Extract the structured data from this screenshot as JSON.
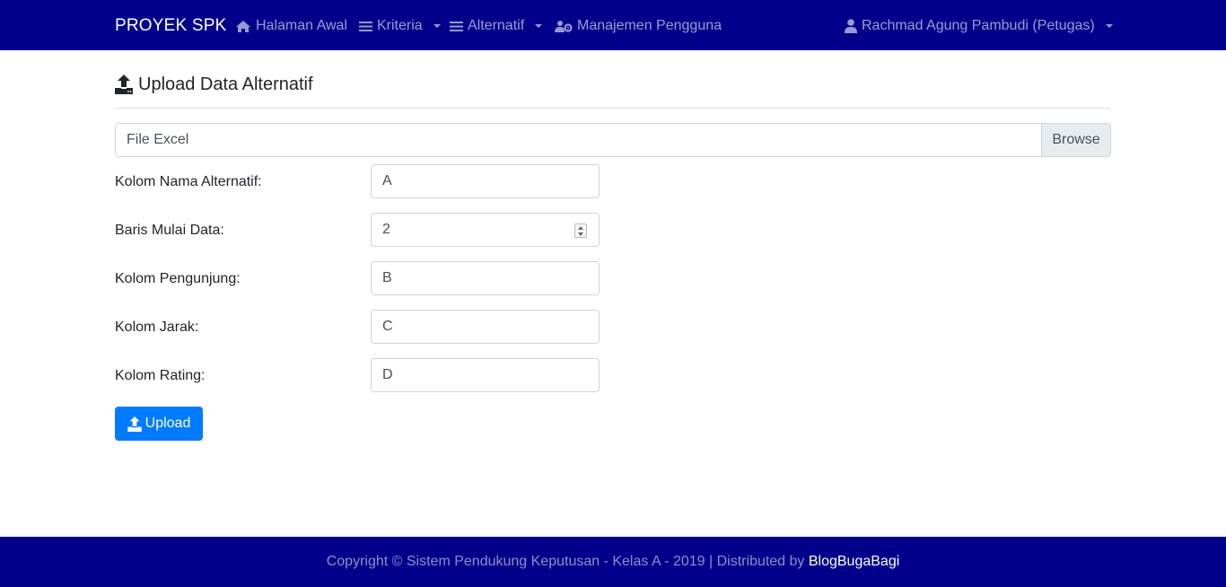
{
  "navbar": {
    "brand": "PROYEK SPK",
    "items": [
      {
        "label": "Halaman Awal",
        "icon": "home-icon"
      },
      {
        "label": "Kriteria",
        "icon": "bars-icon",
        "dropdown": true
      },
      {
        "label": "Alternatif",
        "icon": "bars-icon",
        "dropdown": true
      },
      {
        "label": "Manajemen Pengguna",
        "icon": "users-cog-icon"
      }
    ],
    "user": {
      "label": "Rachmad Agung Pambudi (Petugas)",
      "icon": "user-icon",
      "dropdown": true
    }
  },
  "page": {
    "title": "Upload Data Alternatif",
    "title_icon": "upload-icon"
  },
  "form": {
    "file": {
      "label": "File Excel",
      "button": "Browse"
    },
    "fields": [
      {
        "label": "Kolom Nama Alternatif:",
        "value": "A"
      },
      {
        "label": "Baris Mulai Data:",
        "value": "2",
        "type": "number"
      },
      {
        "label": "Kolom Pengunjung:",
        "value": "B"
      },
      {
        "label": "Kolom Jarak:",
        "value": "C"
      },
      {
        "label": "Kolom Rating:",
        "value": "D"
      }
    ],
    "submit": {
      "label": "Upload",
      "icon": "upload-icon"
    }
  },
  "footer": {
    "text": "Copyright © Sistem Pendukung Keputusan - Kelas A - 2019 | Distributed by",
    "link": "BlogBugaBagi"
  },
  "colors": {
    "navbar": "#00008b",
    "primary": "#007bff"
  }
}
